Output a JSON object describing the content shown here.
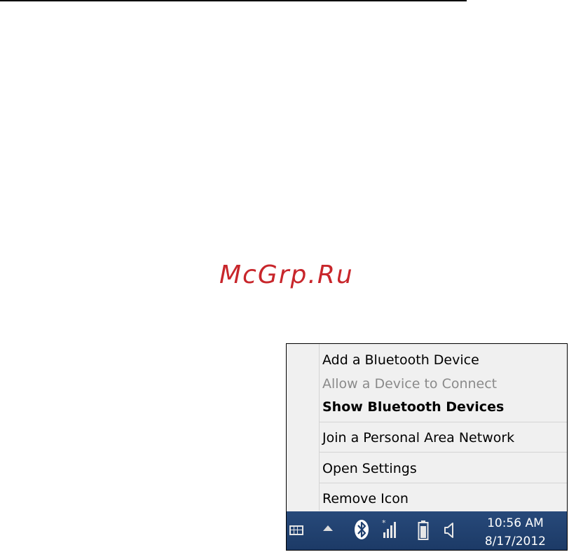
{
  "watermark": "McGrp.Ru",
  "menu": {
    "items": [
      {
        "label": "Add a Bluetooth Device"
      },
      {
        "label": "Allow a Device to Connect"
      },
      {
        "label": "Show Bluetooth Devices"
      },
      {
        "label": "Join a Personal Area Network"
      },
      {
        "label": "Open Settings"
      },
      {
        "label": "Remove Icon"
      }
    ]
  },
  "taskbar": {
    "time": "10:56 AM",
    "date": "8/17/2012",
    "icons": [
      "keyboard-icon",
      "chevron-up-icon",
      "bluetooth-icon",
      "signal-icon",
      "battery-icon",
      "speaker-icon"
    ]
  },
  "colors": {
    "watermark": "#c8262b",
    "taskbar": "#1f3f6e",
    "menu_bg": "#f0f0f0",
    "disabled_text": "#8a8a8a"
  }
}
